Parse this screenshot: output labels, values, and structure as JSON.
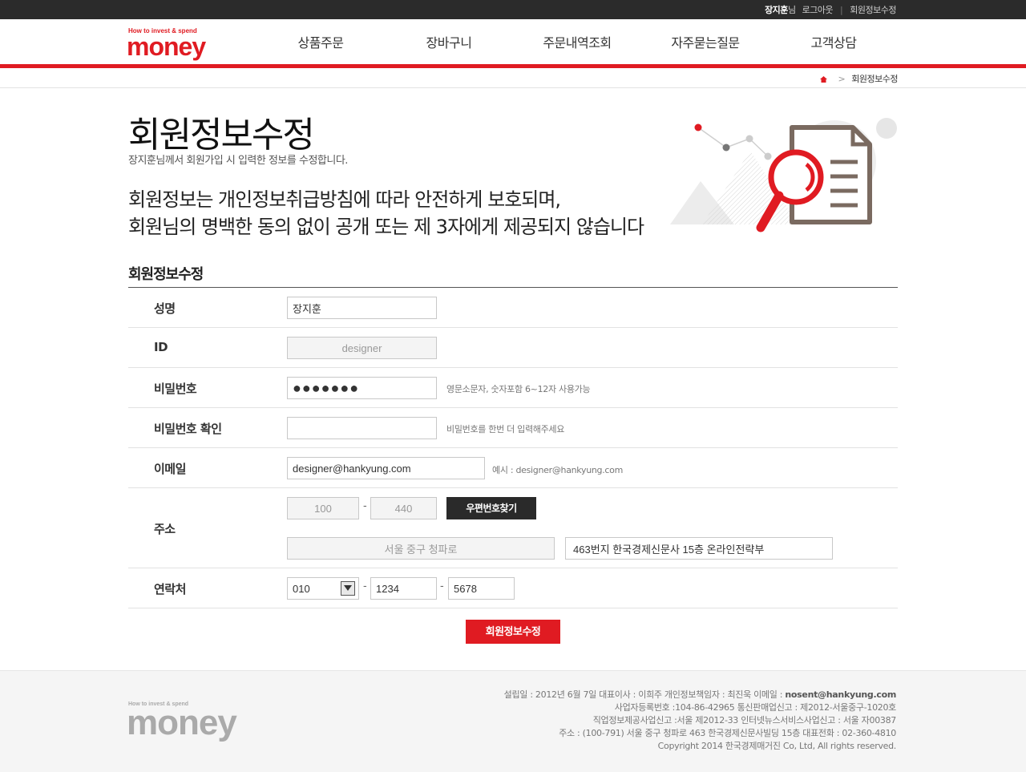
{
  "topbar": {
    "user_name": "장지훈",
    "user_suffix": "님",
    "logout": "로그아웃",
    "sep": "|",
    "edit_info": "회원정보수정"
  },
  "logo": {
    "tagline": "How to invest & spend",
    "word": "money"
  },
  "nav": {
    "items": [
      "상품주문",
      "장바구니",
      "주문내역조회",
      "자주묻는질문",
      "고객상담"
    ]
  },
  "breadcrumb": {
    "arrow": ">",
    "current": "회원정보수정"
  },
  "page": {
    "title": "회원정보수정",
    "subtitle": "장지훈님께서 회원가입 시 입력한 정보를 수정합니다.",
    "notice_line1": "회원정보는 개인정보취급방침에 따라 안전하게 보호되며,",
    "notice_line2": "회원님의 명백한 동의 없이 공개 또는 제 3자에게 제공되지 않습니다",
    "section_title": "회원정보수정"
  },
  "form": {
    "name": {
      "label": "성명",
      "value": "장지훈"
    },
    "id": {
      "label": "ID",
      "value": "designer"
    },
    "password": {
      "label": "비밀번호",
      "value": "●●●●●●●",
      "hint": "영문소문자, 숫자포함 6~12자 사용가능"
    },
    "password_confirm": {
      "label": "비밀번호 확인",
      "value": "",
      "hint": "비밀번호를 한번 더 입력해주세요"
    },
    "email": {
      "label": "이메일",
      "value": "designer@hankyung.com",
      "hint": "예시 : designer@hankyung.com"
    },
    "address": {
      "label": "주소",
      "zip1": "100",
      "zip2": "440",
      "dash": "-",
      "zip_button": "우편번호찾기",
      "addr1": "서울 중구 청파로",
      "addr2": "463번지 한국경제신문사 15층 온라인전략부"
    },
    "phone": {
      "label": "연락처",
      "prefix": "010",
      "middle": "1234",
      "last": "5678",
      "dash": "-"
    },
    "submit": "회원정보수정"
  },
  "footer": {
    "logo_tagline": "How to invest & spend",
    "logo_word": "money",
    "line1_pre": "설립일 : 2012년 6월 7일 대표이사 : 이희주 개인정보책임자 : 최진욱 이메일 : ",
    "line1_email": "nosent@hankyung.com",
    "line2": "사업자등록번호 :104-86-42965 통신판매업신고 : 제2012-서울중구-1020호",
    "line3": "직업정보제공사업신고 :서울 제2012-33 인터넷뉴스서비스사업신고 : 서울 자00387",
    "line4": "주소 : (100-791) 서울 중구 청파로 463 한국경제신문사빌딩 15층 대표전화 : 02-360-4810",
    "line5": "Copyright 2014 한국경제매거진 Co, Ltd, All rights reserved."
  },
  "colors": {
    "brand_red": "#e01b22",
    "topbar": "#2b2b2b",
    "dark_button": "#2a2a2a"
  }
}
